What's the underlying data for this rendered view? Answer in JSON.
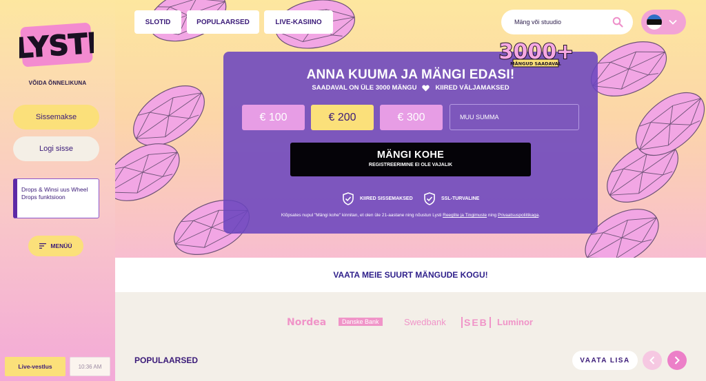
{
  "brand": {
    "logo_text": "LYSTI",
    "tagline": "VÕIDA ÕNNELIKUNA"
  },
  "sidebar": {
    "deposit_label": "Sissemakse",
    "login_label": "Logi sisse",
    "promo_text": "Drops & Winsi uus Wheel Drops funktsioon",
    "menu_label": "MENÜÜ",
    "chat_label": "Live-vestlus",
    "time": "10:36 AM"
  },
  "nav": {
    "tabs": [
      {
        "label": "SLOTID"
      },
      {
        "label": "POPULAARSED"
      },
      {
        "label": "LIVE-KASIINO"
      }
    ],
    "search_placeholder": "Mäng või stuudio",
    "language_flag": "estonia-flag"
  },
  "hero": {
    "badge_number": "3000+",
    "badge_caption": "MÄNGUD SAADAVAL",
    "title": "ANNA KUUMA JA MÄNGI EDASI!",
    "sub_left": "SAADAVAL ON ÜLE 3000 MÄNGU",
    "sub_right": "KIIRED VÄLJAMAKSED",
    "amounts": [
      "€ 100",
      "€ 200",
      "€ 300"
    ],
    "selected_amount": "€ 200",
    "custom_amount_placeholder": "MUU SUMMA",
    "play_label": "MÄNGI KOHE",
    "play_sublabel": "REGISTREERIMINE EI OLE VAJALIK",
    "trust_1": "KIIRED SISSEMAKSED",
    "trust_2": "SSL-TURVALINE",
    "legal_pre": "Klõpsates nupul \"Mängi kohe\" kinnitan, et olen üle 21-aastane ning nõustun Lysti ",
    "legal_link1": "Reeglite ja Tingimuste",
    "legal_mid": " ning ",
    "legal_link2": "Privaatsuspoliitikaga",
    "legal_end": "."
  },
  "collection_text": "VAATA MEIE SUURT MÄNGUDE KOGU!",
  "banks": [
    "Nordea",
    "Danske Bank",
    "Swedbank",
    "SEB",
    "Luminor"
  ],
  "popular": {
    "title": "POPULAARSED",
    "see_more": "VAATA LISA"
  },
  "colors": {
    "accent_yellow": "#fbe07a",
    "brand_purple": "#3a1a78",
    "panel_purple": "#6b46be",
    "pink": "#e79de5",
    "bank_pink": "#f094c8"
  }
}
